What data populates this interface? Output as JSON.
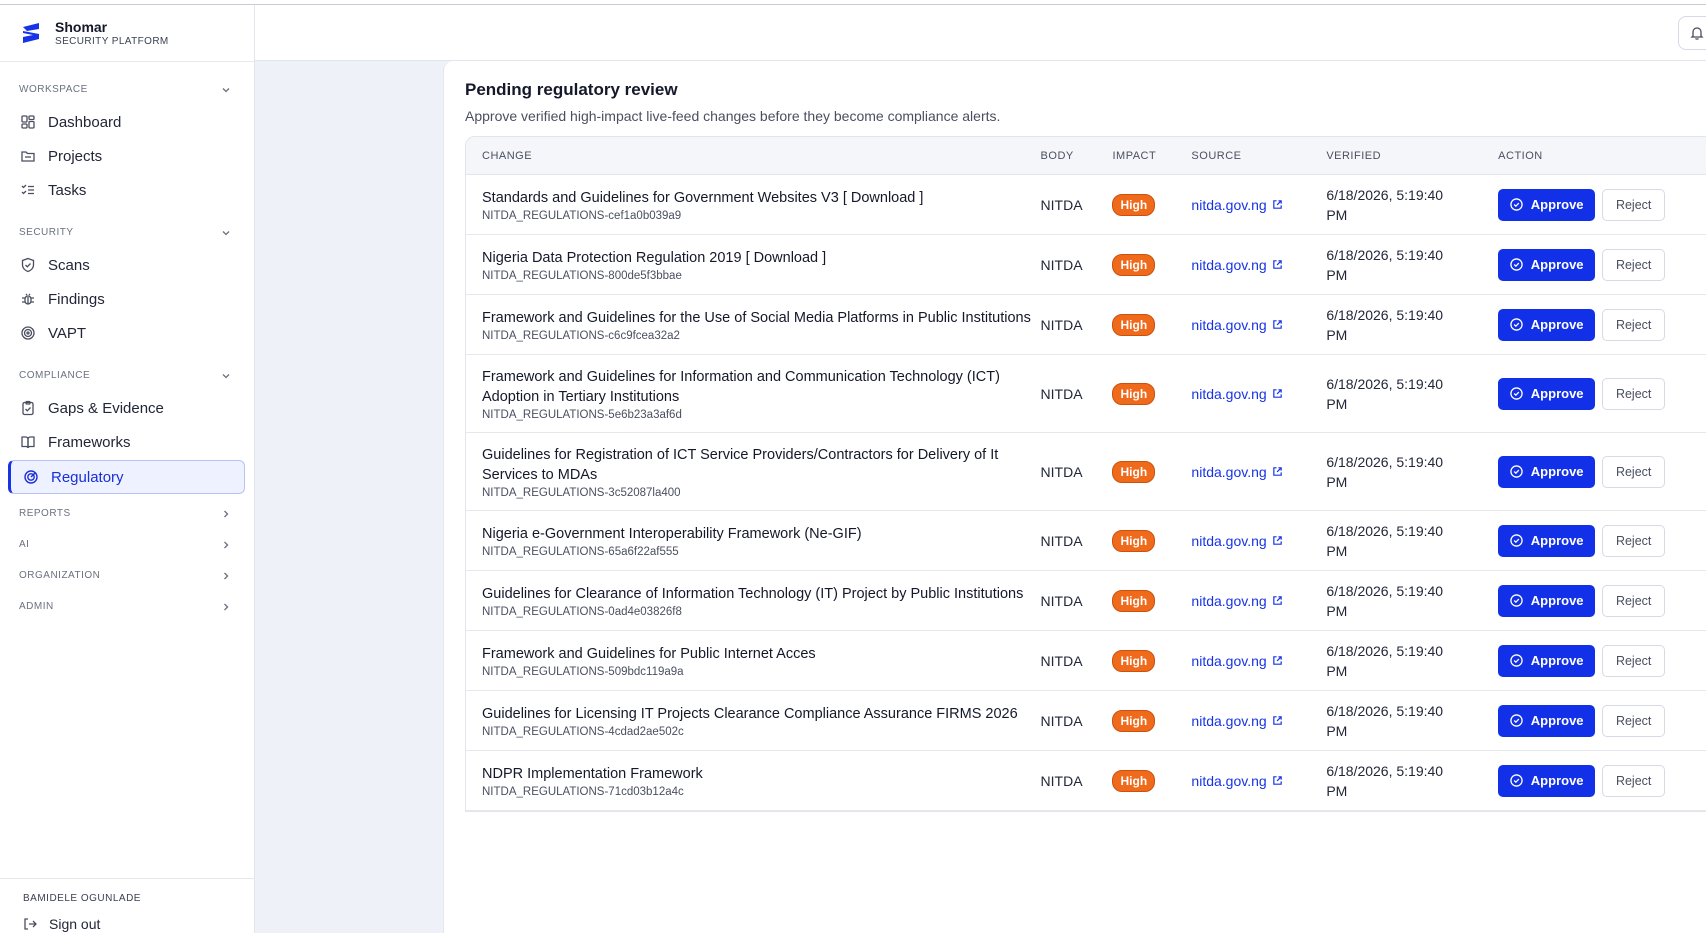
{
  "brand": {
    "name": "Shomar",
    "subtitle": "SECURITY PLATFORM"
  },
  "sidebar": {
    "sections": [
      {
        "label": "WORKSPACE",
        "expanded": true,
        "items": [
          {
            "label": "Dashboard",
            "icon": "dashboard-grid-icon"
          },
          {
            "label": "Projects",
            "icon": "folder-icon"
          },
          {
            "label": "Tasks",
            "icon": "checklist-icon"
          }
        ]
      },
      {
        "label": "SECURITY",
        "expanded": true,
        "items": [
          {
            "label": "Scans",
            "icon": "shield-check-icon"
          },
          {
            "label": "Findings",
            "icon": "bug-icon"
          },
          {
            "label": "VAPT",
            "icon": "target-icon"
          }
        ]
      },
      {
        "label": "COMPLIANCE",
        "expanded": true,
        "items": [
          {
            "label": "Gaps & Evidence",
            "icon": "clipboard-check-icon"
          },
          {
            "label": "Frameworks",
            "icon": "book-icon"
          },
          {
            "label": "Regulatory",
            "icon": "radar-icon",
            "active": true
          }
        ]
      },
      {
        "label": "REPORTS",
        "expanded": false,
        "items": []
      },
      {
        "label": "AI",
        "expanded": false,
        "items": []
      },
      {
        "label": "ORGANIZATION",
        "expanded": false,
        "items": []
      },
      {
        "label": "ADMIN",
        "expanded": false,
        "items": []
      }
    ],
    "user_name": "BAMIDELE OGUNLADE",
    "sign_out_label": "Sign out"
  },
  "colors": {
    "accent": "#1130e8",
    "high_badge": "#f06a1c"
  },
  "main": {
    "title": "Pending regulatory review",
    "subtitle": "Approve verified high-impact live-feed changes before they become compliance alerts.",
    "columns": {
      "change": "CHANGE",
      "body": "BODY",
      "impact": "IMPACT",
      "source": "SOURCE",
      "verified": "VERIFIED",
      "action": "ACTION"
    },
    "approve_label": "Approve",
    "reject_label": "Reject",
    "rows": [
      {
        "title": "Standards and Guidelines for Government Websites V3 [ Download ]",
        "id": "NITDA_REGULATIONS-cef1a0b039a9",
        "body": "NITDA",
        "impact": "High",
        "source": "nitda.gov.ng",
        "verified": "6/18/2026, 5:19:40 PM"
      },
      {
        "title": "Nigeria Data Protection Regulation 2019 [ Download ]",
        "id": "NITDA_REGULATIONS-800de5f3bbae",
        "body": "NITDA",
        "impact": "High",
        "source": "nitda.gov.ng",
        "verified": "6/18/2026, 5:19:40 PM"
      },
      {
        "title": "Framework and Guidelines for the Use of Social Media Platforms in Public Institutions",
        "id": "NITDA_REGULATIONS-c6c9fcea32a2",
        "body": "NITDA",
        "impact": "High",
        "source": "nitda.gov.ng",
        "verified": "6/18/2026, 5:19:40 PM"
      },
      {
        "title": "Framework and Guidelines for Information and Communication Technology (ICT) Adoption in Tertiary Institutions",
        "id": "NITDA_REGULATIONS-5e6b23a3af6d",
        "body": "NITDA",
        "impact": "High",
        "source": "nitda.gov.ng",
        "verified": "6/18/2026, 5:19:40 PM"
      },
      {
        "title": "Guidelines for Registration of ICT Service Providers/Contractors for Delivery of It Services to MDAs",
        "id": "NITDA_REGULATIONS-3c52087la400",
        "body": "NITDA",
        "impact": "High",
        "source": "nitda.gov.ng",
        "verified": "6/18/2026, 5:19:40 PM"
      },
      {
        "title": "Nigeria e-Government Interoperability Framework (Ne-GIF)",
        "id": "NITDA_REGULATIONS-65a6f22af555",
        "body": "NITDA",
        "impact": "High",
        "source": "nitda.gov.ng",
        "verified": "6/18/2026, 5:19:40 PM"
      },
      {
        "title": "Guidelines for Clearance of Information Technology (IT) Project by Public Institutions",
        "id": "NITDA_REGULATIONS-0ad4e03826f8",
        "body": "NITDA",
        "impact": "High",
        "source": "nitda.gov.ng",
        "verified": "6/18/2026, 5:19:40 PM"
      },
      {
        "title": "Framework and Guidelines for Public Internet Acces",
        "id": "NITDA_REGULATIONS-509bdc119a9a",
        "body": "NITDA",
        "impact": "High",
        "source": "nitda.gov.ng",
        "verified": "6/18/2026, 5:19:40 PM"
      },
      {
        "title": "Guidelines for Licensing IT Projects Clearance Compliance Assurance FIRMS 2026",
        "id": "NITDA_REGULATIONS-4cdad2ae502c",
        "body": "NITDA",
        "impact": "High",
        "source": "nitda.gov.ng",
        "verified": "6/18/2026, 5:19:40 PM"
      },
      {
        "title": "NDPR Implementation Framework",
        "id": "NITDA_REGULATIONS-71cd03b12a4c",
        "body": "NITDA",
        "impact": "High",
        "source": "nitda.gov.ng",
        "verified": "6/18/2026, 5:19:40 PM"
      }
    ]
  }
}
